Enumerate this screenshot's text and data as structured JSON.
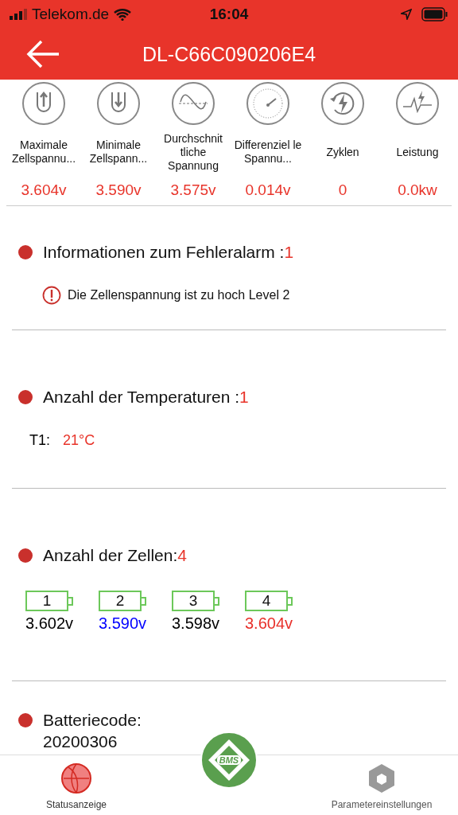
{
  "status_bar": {
    "carrier": "Telekom.de",
    "time": "16:04"
  },
  "header": {
    "title": "DL-C66C090206E4"
  },
  "metrics": [
    {
      "kind": "max",
      "label": "Maximale Zellspannu...",
      "value": "3.604v"
    },
    {
      "kind": "min",
      "label": "Minimale Zellspann...",
      "value": "3.590v"
    },
    {
      "kind": "avg",
      "label": "Durchschnit tliche Spannung",
      "value": "3.575v"
    },
    {
      "kind": "diff",
      "label": "Differenziel le Spannu...",
      "value": "0.014v"
    },
    {
      "kind": "cycles",
      "label": "Zyklen",
      "value": "0"
    },
    {
      "kind": "power",
      "label": "Leistung",
      "value": "0.0kw"
    }
  ],
  "alarm_section": {
    "title": "Informationen zum Fehleralarm :",
    "count": "1",
    "alarms": [
      "Die Zellenspannung ist zu hoch Level 2"
    ]
  },
  "temperature_section": {
    "title": "Anzahl der Temperaturen :",
    "count": "1",
    "sensors": [
      {
        "name": "T1:",
        "value": "21°C"
      }
    ]
  },
  "cells_section": {
    "title": "Anzahl der Zellen:",
    "count": "4",
    "cells": [
      {
        "number": "1",
        "voltage": "3.602v",
        "color": "#000000"
      },
      {
        "number": "2",
        "voltage": "3.590v",
        "color": "#0000ff"
      },
      {
        "number": "3",
        "voltage": "3.598v",
        "color": "#000000"
      },
      {
        "number": "4",
        "voltage": "3.604v",
        "color": "#e8302a"
      }
    ]
  },
  "code_section": {
    "title": "Batteriecode:",
    "value": "20200306"
  },
  "tab_bar": {
    "center_logo": "BMS",
    "tabs": [
      {
        "label": "Statusanzeige",
        "selected": true
      },
      {
        "label": "Parametereinstellungen",
        "selected": false
      }
    ]
  }
}
